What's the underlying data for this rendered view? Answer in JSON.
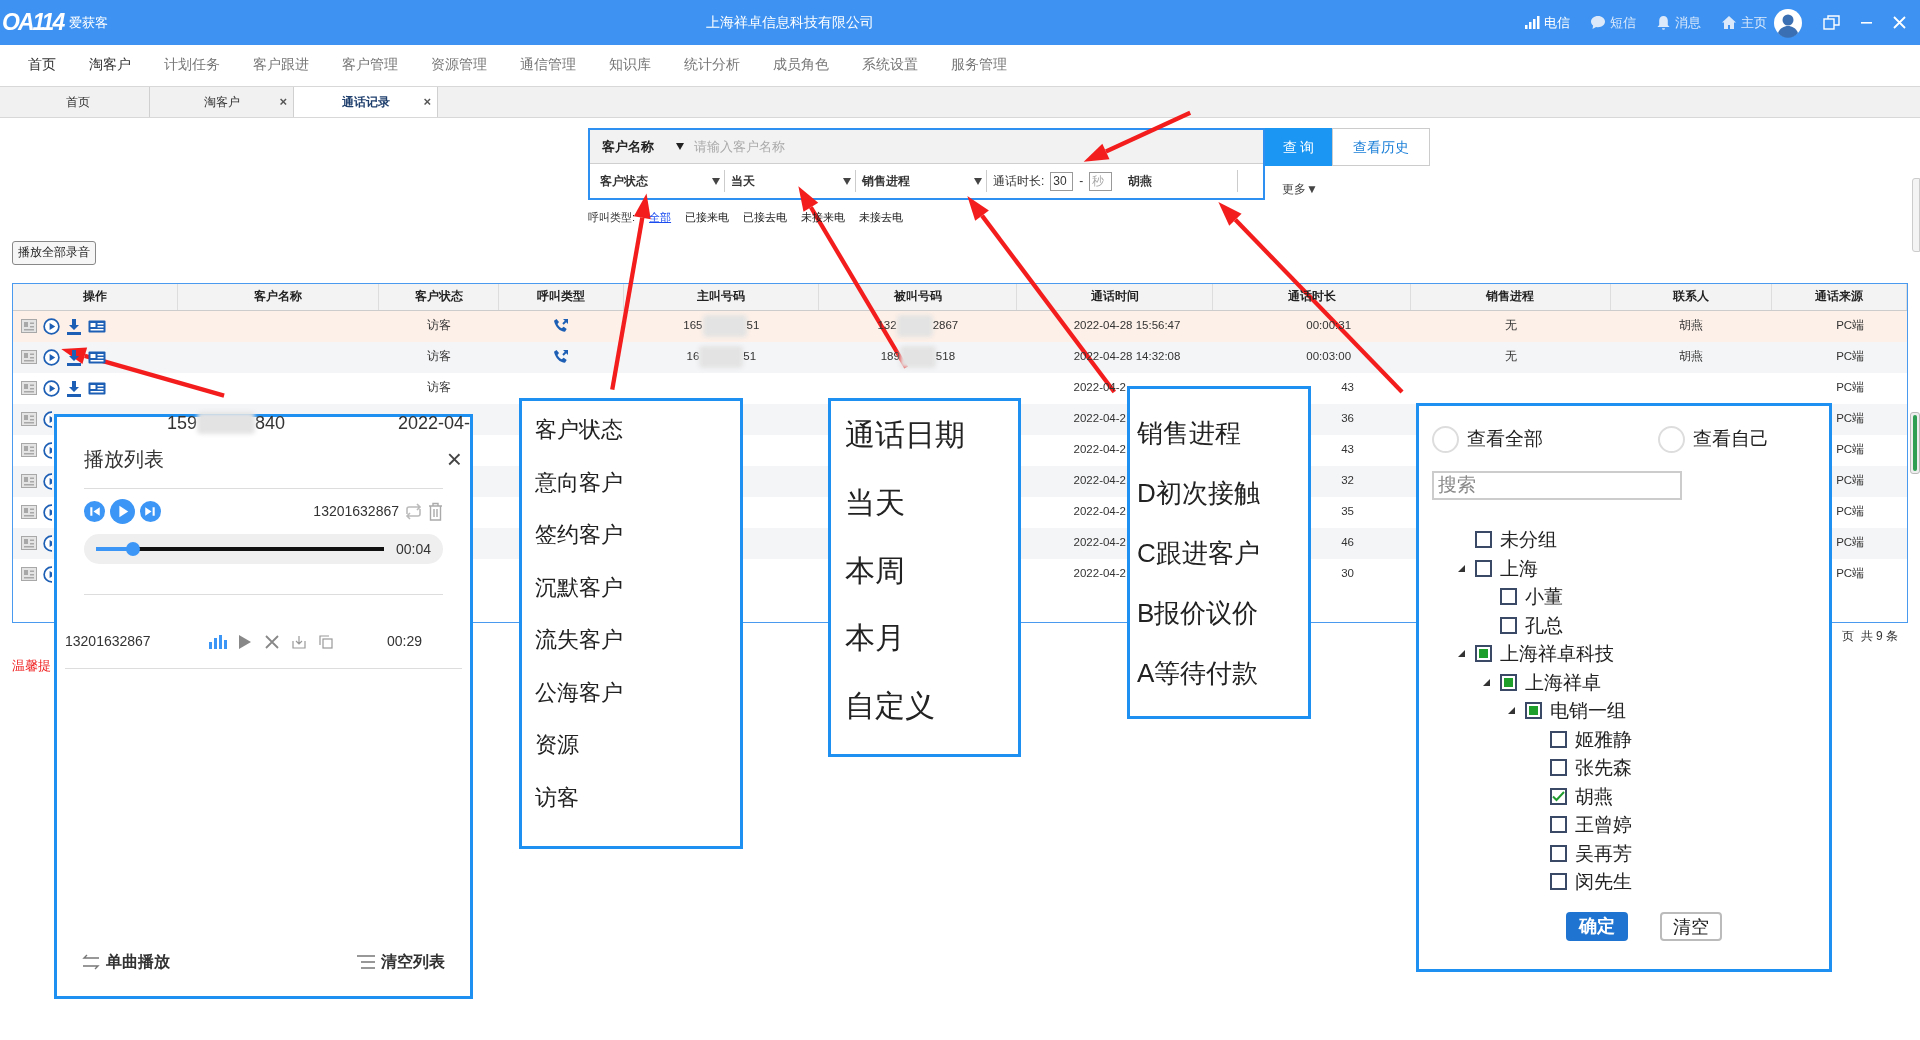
{
  "title_bar": {
    "logo": "OA114",
    "brand": "爱获客",
    "title": "上海祥卓信息科技有限公司",
    "actions": [
      {
        "kind": "signal",
        "label": "电信"
      },
      {
        "kind": "chat",
        "label": "短信"
      },
      {
        "kind": "bell",
        "label": "消息"
      },
      {
        "kind": "home",
        "label": "主页"
      }
    ]
  },
  "menu": [
    "首页",
    "淘客户",
    "计划任务",
    "客户跟进",
    "客户管理",
    "资源管理",
    "通信管理",
    "知识库",
    "统计分析",
    "成员角色",
    "系统设置",
    "服务管理"
  ],
  "tabs": [
    {
      "label": "首页",
      "selected": false,
      "closable": false
    },
    {
      "label": "淘客户",
      "selected": false,
      "closable": true
    },
    {
      "label": "通话记录",
      "selected": true,
      "closable": true
    }
  ],
  "tab_close": "×",
  "search": {
    "name_select": "客户名称",
    "name_placeholder": "请输入客户名称",
    "status_select": "客户状态",
    "date_select": "当天",
    "sales_select": "销售进程",
    "duration_label": "通话时长:",
    "duration_value": "30",
    "duration_separator": "-",
    "duration_unit_placeholder": "秒",
    "contact": "胡燕",
    "query_button": "查 询",
    "history_button": "查看历史",
    "more": "更多▼"
  },
  "call_types": {
    "label": "呼叫类型:",
    "options": [
      {
        "label": "全部",
        "selected": true
      },
      {
        "label": "已接来电",
        "selected": false
      },
      {
        "label": "已接去电",
        "selected": false
      },
      {
        "label": "未接来电",
        "selected": false
      },
      {
        "label": "未接去电",
        "selected": false
      }
    ]
  },
  "play_all_button": "播放全部录音",
  "table": {
    "columns": [
      "操作",
      "客户名称",
      "客户状态",
      "呼叫类型",
      "主叫号码",
      "被叫号码",
      "通话时间",
      "通话时长",
      "销售进程",
      "联系人",
      "通话来源"
    ],
    "rows": [
      {
        "kind": "full",
        "selected": true,
        "status": "访客",
        "caller": [
          "165",
          "51"
        ],
        "callee": [
          "132",
          "2867"
        ],
        "time": "2022-04-28 15:56:47",
        "duration": "00:00:31",
        "sales": "无",
        "contact": "胡燕",
        "source": "PC端"
      },
      {
        "kind": "full",
        "selected": false,
        "status": "访客",
        "caller": [
          "16",
          "51"
        ],
        "callee": [
          "189",
          "518"
        ],
        "time": "2022-04-28 14:32:08",
        "duration": "00:03:00",
        "sales": "无",
        "contact": "胡燕",
        "source": "PC端"
      },
      {
        "kind": "partial",
        "selected": false,
        "status": "访客",
        "time": "2022-04-2",
        "duration": "43",
        "source": "PC端"
      },
      {
        "kind": "covered",
        "selected": false,
        "time": "2022-04-2",
        "duration": "36",
        "source": "PC端"
      },
      {
        "kind": "covered",
        "selected": false,
        "time": "2022-04-2",
        "duration": "43",
        "source": "PC端"
      },
      {
        "kind": "covered",
        "selected": false,
        "time": "2022-04-2",
        "duration": "32",
        "source": "PC端"
      },
      {
        "kind": "covered",
        "selected": false,
        "time": "2022-04-2",
        "duration": "35",
        "source": "PC端"
      },
      {
        "kind": "covered",
        "selected": false,
        "time": "2022-04-2",
        "duration": "46",
        "source": "PC端"
      },
      {
        "kind": "covered",
        "selected": false,
        "time": "2022-04-2",
        "duration": "30",
        "source": "PC端"
      }
    ]
  },
  "pagination": "页  共 9 条",
  "notice": "温馨提",
  "player": {
    "peek": [
      "159",
      "840",
      "2022-04-"
    ],
    "title": "播放列表",
    "close": "×",
    "number": "13201632867",
    "level": 0.13,
    "elapsed": "00:04",
    "items": [
      {
        "number": "13201632867",
        "length": "00:29"
      }
    ],
    "single_play": "单曲播放",
    "clear_list": "清空列表"
  },
  "status_list": [
    "客户状态",
    "意向客户",
    "签约客户",
    "沉默客户",
    "流失客户",
    "公海客户",
    "资源",
    "访客"
  ],
  "date_list": [
    "通话日期",
    "当天",
    "本周",
    "本月",
    "自定义"
  ],
  "sales_list": [
    "销售进程",
    "D初次接触",
    "C跟进客户",
    "B报价议价",
    "A等待付款"
  ],
  "contact_picker": {
    "options": [
      {
        "label": "查看全部",
        "selected": false
      },
      {
        "label": "查看自己",
        "selected": false
      }
    ],
    "search_placeholder": "搜索",
    "tree": [
      {
        "label": "未分组",
        "checked": false
      },
      {
        "label": "上海",
        "checked": false,
        "expanded": true,
        "children": [
          {
            "label": "小董",
            "checked": false
          },
          {
            "label": "孔总",
            "checked": false
          }
        ]
      },
      {
        "label": "上海祥卓科技",
        "checked": false,
        "partial": true,
        "expanded": true,
        "children": [
          {
            "label": "上海祥卓",
            "checked": false,
            "partial": true,
            "expanded": true,
            "children": [
              {
                "label": "电销一组",
                "checked": false,
                "partial": true,
                "expanded": true,
                "children": [
                  {
                    "label": "姬雅静",
                    "checked": false
                  },
                  {
                    "label": "张先森",
                    "checked": false
                  },
                  {
                    "label": "胡燕",
                    "checked": true
                  },
                  {
                    "label": "王曾婷",
                    "checked": false
                  },
                  {
                    "label": "吴再芳",
                    "checked": false
                  },
                  {
                    "label": "闵先生",
                    "checked": false
                  }
                ]
              }
            ]
          }
        ]
      }
    ],
    "confirm": "确定",
    "clear": "清空"
  }
}
